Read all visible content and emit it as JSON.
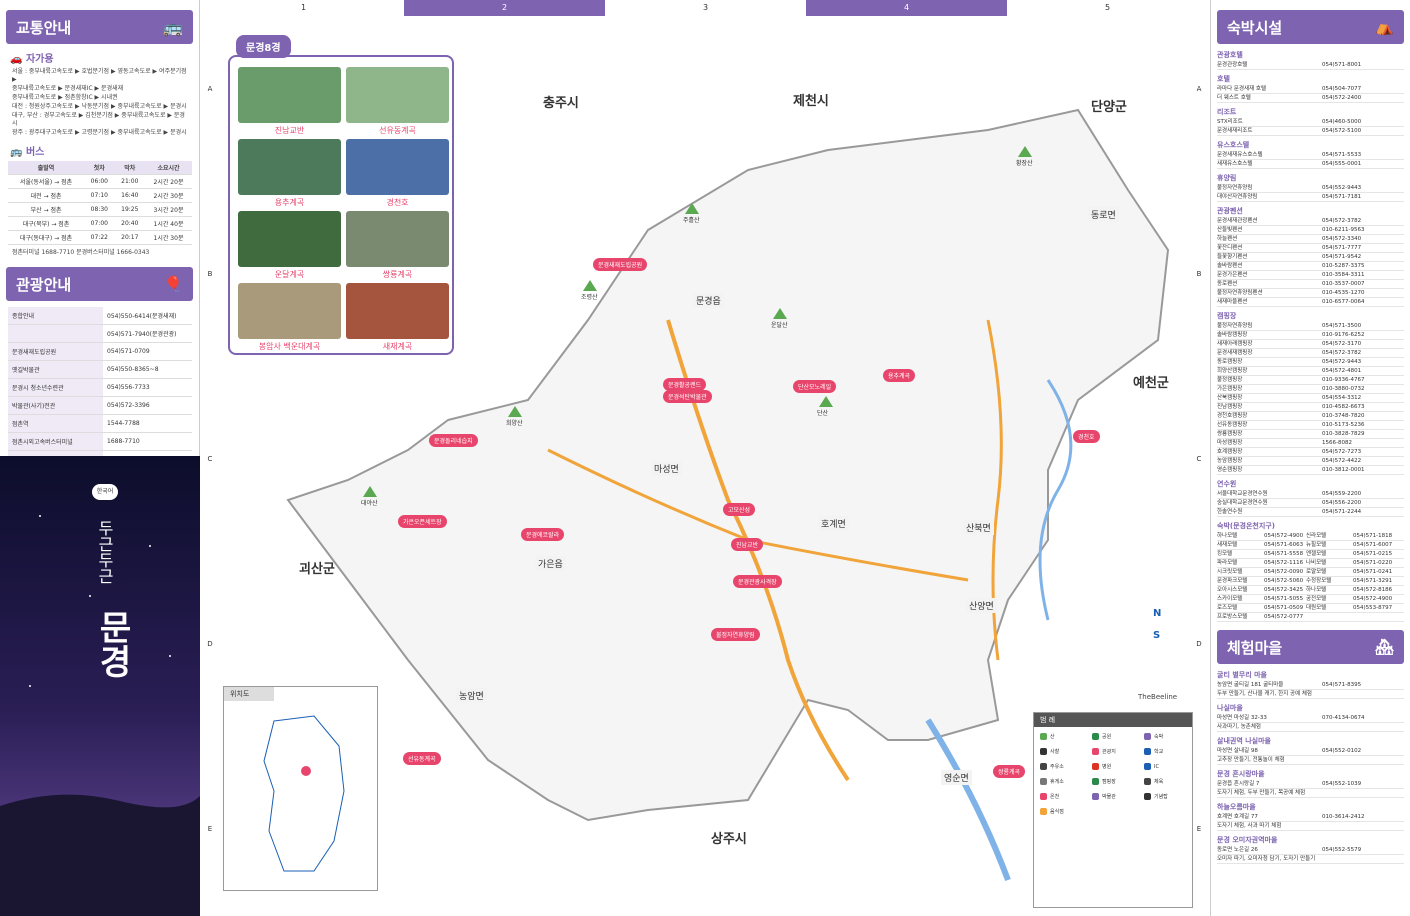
{
  "left": {
    "traffic_title": "교통안내",
    "car_title": "자가용",
    "car_routes": [
      "서울 : 중부내륙고속도로 ▶ 호법분기점 ▶ 영동고속도로 ▶ 여주분기점 ▶",
      "중부내륙고속도로 ▶ 문경새재IC ▶ 문경새재",
      "중부내륙고속도로 ▶ 점촌함창IC ▶ 시내권",
      "대전 : 청원상주고속도로 ▶ 낙동분기점 ▶ 중부내륙고속도로 ▶ 문경시",
      "대구, 부산 : 경부고속도로 ▶ 김천분기점 ▶ 중부내륙고속도로 ▶ 문경시",
      "광주 : 광주대구고속도로 ▶ 고령분기점 ▶ 중부내륙고속도로 ▶ 문경시"
    ],
    "bus_title": "버스",
    "bus_headers": [
      "출발역",
      "첫차",
      "막차",
      "소요시간"
    ],
    "bus_rows": [
      [
        "서울(동서울) → 점촌",
        "06:00",
        "21:00",
        "2시간 20분"
      ],
      [
        "대전 → 점촌",
        "07:10",
        "16:40",
        "2시간 30분"
      ],
      [
        "부산 → 점촌",
        "08:30",
        "19:25",
        "3시간 20분"
      ],
      [
        "대구(북부) → 점촌",
        "07:00",
        "20:40",
        "1시간 40분"
      ],
      [
        "대구(동대구) → 점촌",
        "07:22",
        "20:17",
        "1시간 30분"
      ]
    ],
    "bus_note": "점촌터미널 1688-7710  문경버스터미널 1666-0343",
    "tour_title": "관광안내",
    "tour_rows": [
      [
        "종합안내",
        "054)550-6414(문경새재)"
      ],
      [
        "",
        "054)571-7940(문경관광)"
      ],
      [
        "문경새재도립공원",
        "054)571-0709"
      ],
      [
        "옛길박물관",
        "054)550-8365~8"
      ],
      [
        "문경시 청소년수련관",
        "054)556-7733"
      ],
      [
        "박물관(사기)전관",
        "054)572-3396"
      ],
      [
        "점촌역",
        "1544-7788"
      ],
      [
        "점촌시외고속버스터미널",
        "1688-7710"
      ],
      [
        "문경시외버스터미널",
        "054)553-2231"
      ],
      [
        "문경버스터미널",
        "1666-0343"
      ],
      [
        "가은버스터미널",
        "054)572-7100"
      ]
    ],
    "cover_badge": "한국어",
    "cover_small": "두근두근",
    "cover_big": "문경"
  },
  "map": {
    "columns": [
      "1",
      "2",
      "3",
      "4",
      "5"
    ],
    "rows": [
      "A",
      "B",
      "C",
      "D",
      "E"
    ],
    "regions": [
      "충주시",
      "제천시",
      "단양군",
      "예천군",
      "괴산군",
      "상주시"
    ],
    "districts": [
      "문경읍",
      "마성면",
      "호계면",
      "가은읍",
      "농암면",
      "동로면",
      "산북면",
      "산양면",
      "영순면"
    ],
    "eight_title": "문경8경",
    "eight": [
      "진남교반",
      "선유동계곡",
      "용추계곡",
      "경천호",
      "운달계곡",
      "쌍룡계곡",
      "봉암사 백운대계곡",
      "새재계곡"
    ],
    "pills": [
      "문경새재도립공원",
      "문경활공랜드",
      "단산모노레일",
      "문경석탄박물관",
      "가은오픈세트장",
      "문경에코랄라",
      "고모산성",
      "진남교반",
      "문경관광사격장",
      "불정자연휴양림",
      "선유동계곡",
      "용추계곡",
      "경천호",
      "쌍룡계곡",
      "문경돌리네습지"
    ],
    "peaks": [
      "주흘산",
      "조령산",
      "희양산",
      "대야산",
      "단산",
      "황장산",
      "운달산"
    ],
    "locator_title": "위치도",
    "legend_title": "범 례",
    "legend_items": [
      "산",
      "공원",
      "숙박",
      "사찰",
      "관광지",
      "학교",
      "주유소",
      "병원",
      "IC",
      "휴게소",
      "캠핑장",
      "체육",
      "온천",
      "박물관",
      "기념탑",
      "음식점"
    ],
    "brand": "TheBeeline"
  },
  "right": {
    "lodge_title": "숙박시설",
    "lodge": [
      {
        "cat": "관광호텔",
        "rows": [
          [
            "문경관광호텔",
            "054)571-8001"
          ]
        ]
      },
      {
        "cat": "호텔",
        "rows": [
          [
            "라마다 문경새재 호텔",
            "054)504-7077"
          ],
          [
            "더 웨스트 호텔",
            "054)572-2400"
          ]
        ]
      },
      {
        "cat": "리조트",
        "rows": [
          [
            "STX리조트",
            "054)460-5000"
          ],
          [
            "문경새재리조트",
            "054)572-5100"
          ]
        ]
      },
      {
        "cat": "유스호스텔",
        "rows": [
          [
            "문경새재유스호스텔",
            "054)571-5533"
          ],
          [
            "새재유스호스텔",
            "054)555-0001"
          ]
        ]
      },
      {
        "cat": "휴양림",
        "rows": [
          [
            "불정자연휴양림",
            "054)552-9443"
          ],
          [
            "대야산자연휴양림",
            "054)571-7181"
          ]
        ]
      },
      {
        "cat": "관광펜션",
        "rows": [
          [
            "문경새재관광펜션",
            "054)572-3782"
          ],
          [
            "산들빛펜션",
            "010-6211-9563"
          ],
          [
            "하늘펜션",
            "054)572-3340"
          ],
          [
            "꽃잔디펜션",
            "054)571-7777"
          ],
          [
            "들꽃향기펜션",
            "054)571-9542"
          ],
          [
            "솔바람펜션",
            "010-5287-3375"
          ],
          [
            "문경가은펜션",
            "010-3584-3311"
          ],
          [
            "동로펜션",
            "010-3537-0007"
          ],
          [
            "불정자연휴양림펜션",
            "010-4535-1270"
          ],
          [
            "새재마을펜션",
            "010-6577-0064"
          ]
        ]
      },
      {
        "cat": "캠핑장",
        "rows": [
          [
            "불정자연휴양림",
            "054)571-3500"
          ],
          [
            "솔바람캠핑장",
            "010-9176-6252"
          ],
          [
            "새재아래캠핑장",
            "054)572-3170"
          ],
          [
            "문경새재캠핑장",
            "054)572-3782"
          ],
          [
            "동로캠핑장",
            "054)572-9443"
          ],
          [
            "희양산캠핑장",
            "054)572-4801"
          ],
          [
            "불정캠핑장",
            "010-9336-4767"
          ],
          [
            "가은캠핑장",
            "010-3880-0732"
          ],
          [
            "산북캠핑장",
            "054)554-3312"
          ],
          [
            "진남캠핑장",
            "010-4582-6673"
          ],
          [
            "경천호캠핑장",
            "010-3748-7820"
          ],
          [
            "선유동캠핑장",
            "010-5173-5236"
          ],
          [
            "쌍룡캠핑장",
            "010-3828-7829"
          ],
          [
            "마성캠핑장",
            "1566-8082"
          ],
          [
            "호계캠핑장",
            "054)572-7273"
          ],
          [
            "농암캠핑장",
            "054)572-4422"
          ],
          [
            "영순캠핑장",
            "010-3812-0001"
          ]
        ]
      },
      {
        "cat": "연수원",
        "rows": [
          [
            "서울대학교문경연수원",
            "054)559-2200"
          ],
          [
            "숭실대학교문경연수원",
            "054)556-2200"
          ],
          [
            "한솔연수원",
            "054)571-2244"
          ]
        ]
      }
    ],
    "town_cat": "숙박(문경온천지구)",
    "town_rows": [
      [
        "하나모텔",
        "054)572-4900",
        "신라모텔",
        "054)571-1818"
      ],
      [
        "새재모텔",
        "054)571-6063",
        "뉴힐모텔",
        "054)571-6007"
      ],
      [
        "킹모텔",
        "054)571-5558",
        "엔젤모텔",
        "054)571-0215"
      ],
      [
        "파라모텔",
        "054)572-1116",
        "나비모텔",
        "054)571-0220"
      ],
      [
        "시크릿모텔",
        "054)572-0090",
        "로얄모텔",
        "054)571-0241"
      ],
      [
        "문경파크모텔",
        "054)572-5060",
        "수정장모텔",
        "054)571-3291"
      ],
      [
        "오아시스모텔",
        "054)572-3425",
        "하나모텔",
        "054)572-8186"
      ],
      [
        "스카이모텔",
        "054)571-5055",
        "궁전모텔",
        "054)572-4900"
      ],
      [
        "로즈모텔",
        "054)571-0509",
        "대원모텔",
        "054)553-8797"
      ],
      [
        "프로방스모텔",
        "054)572-0777",
        "",
        ""
      ]
    ],
    "exp_title": "체험마을",
    "exp": [
      {
        "cat": "굴티 별무리 마을",
        "lines": [
          "농암면 굴티길 181 굴티마을",
          "두부 만들기, 산나물 캐기, 한지 공예 체험"
        ],
        "tel": "054)571-8395"
      },
      {
        "cat": "나실마을",
        "lines": [
          "마성면 마성길 32-33",
          "사과따기, 농촌체험"
        ],
        "tel": "070-4134-0674"
      },
      {
        "cat": "살내권역 나실마을",
        "lines": [
          "마성면 살내길 98",
          "고추장 만들기, 전통놀이 체험"
        ],
        "tel": "054)552-0102"
      },
      {
        "cat": "문경 흔시랑마을",
        "lines": [
          "문경읍 흔시랑길 7",
          "도자기 체험, 두부 만들기, 목공예 체험"
        ],
        "tel": "054)552-1039"
      },
      {
        "cat": "하늘오름마을",
        "lines": [
          "호계면 호계길 77",
          "도자기 체험, 사과 따기 체험"
        ],
        "tel": "010-3614-2412"
      },
      {
        "cat": "문경 오미자권역마을",
        "lines": [
          "동로면 노은길 26",
          "오미자 따기, 오미자청 담기, 도자기 만들기"
        ],
        "tel": "054)552-5579"
      }
    ]
  }
}
